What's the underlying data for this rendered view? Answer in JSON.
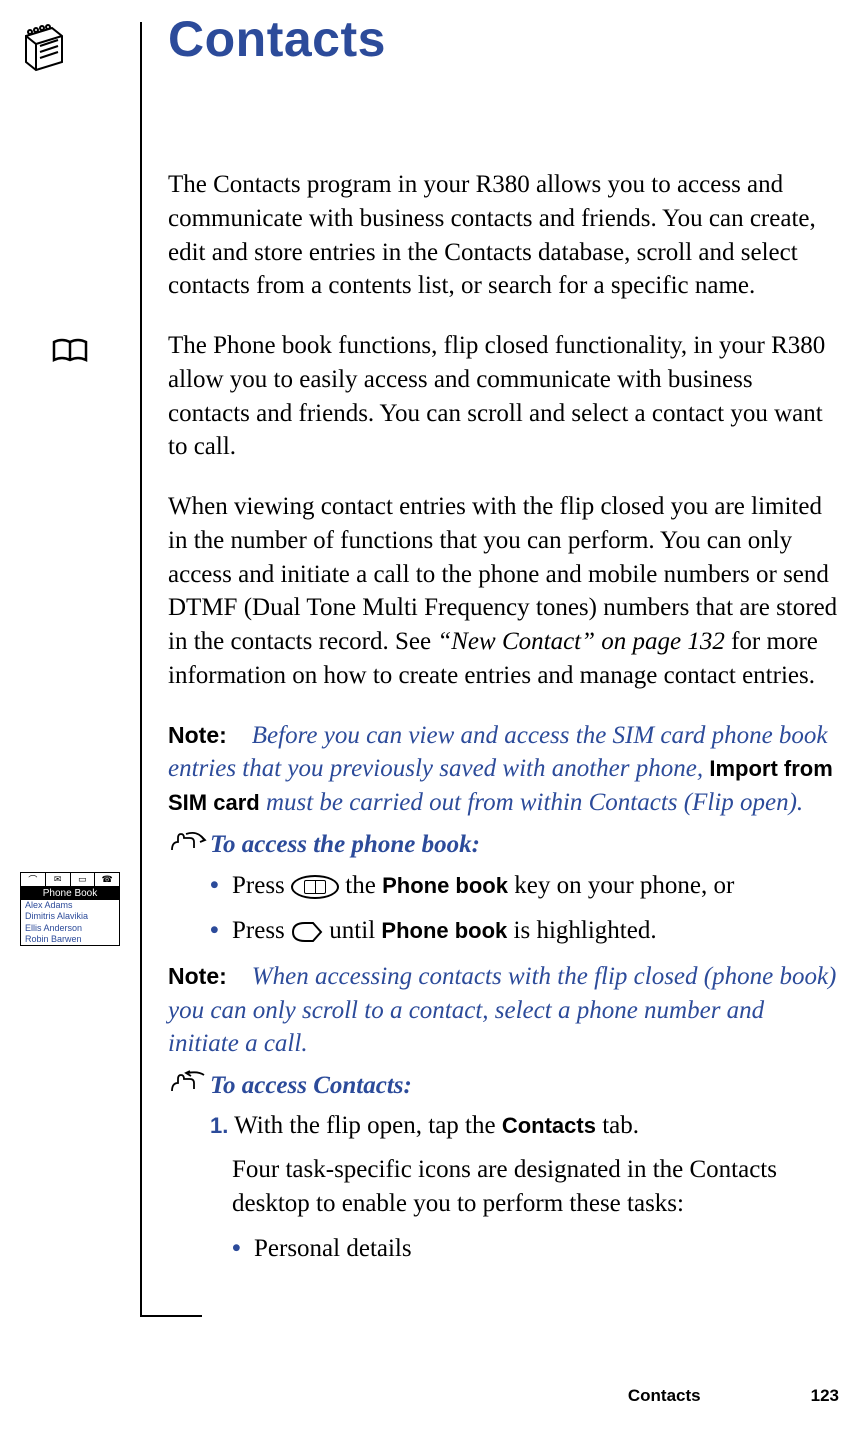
{
  "title": "Contacts",
  "para1": "The Contacts program in your R380 allows you to access and communicate with business contacts and friends. You can create, edit and store entries in the Contacts database, scroll and select contacts from a contents list, or search for a specific name.",
  "para2": "The Phone book functions, flip closed functionality, in your R380 allow you to easily access and communicate with business contacts and friends. You can scroll and select a contact you want to call.",
  "para3_a": "When viewing contact entries with the flip closed you are limited in the number of functions that you can perform. You can only access and initiate a call to the phone and mobile numbers or send DTMF (Dual Tone Multi Frequency tones) numbers that are stored in the contacts record. See ",
  "para3_ref": "“New Contact” on page 132",
  "para3_b": " for more information on how to create entries and manage contact entries.",
  "note_label": "Note:",
  "note1_a": "Before you can view and access the SIM card phone book entries that you previously saved with another phone, ",
  "note1_bold": "Import from SIM card",
  "note1_b": " must be carried out from within Contacts (Flip open).",
  "task1_head": "To access the phone book:",
  "task1_b1_a": "Press ",
  "task1_b1_b": " the ",
  "task1_b1_bold": "Phone book",
  "task1_b1_c": " key on your phone, or",
  "task1_b2_a": "Press ",
  "task1_b2_b": " until ",
  "task1_b2_bold": "Phone book",
  "task1_b2_c": " is highlighted.",
  "note2": "When accessing contacts with the flip closed (phone book) you can only scroll to a contact, select a phone number and initiate a call.",
  "task2_head": "To access Contacts:",
  "step1_num": "1.",
  "step1_a": " With the flip open, tap the ",
  "step1_bold": "Contacts",
  "step1_b": " tab.",
  "step1_sub": "Four task-specific icons are designated in the Contacts desktop to enable you to perform these tasks:",
  "step1_bullet1": "Personal details",
  "pb": {
    "header": "Phone Book",
    "r1": "Alex Adams",
    "r2": "Dimitris Alavikia",
    "r3": "Ellis Anderson",
    "r4": "Robin Barwen"
  },
  "footer": {
    "section": "Contacts",
    "pagenum": "123"
  }
}
